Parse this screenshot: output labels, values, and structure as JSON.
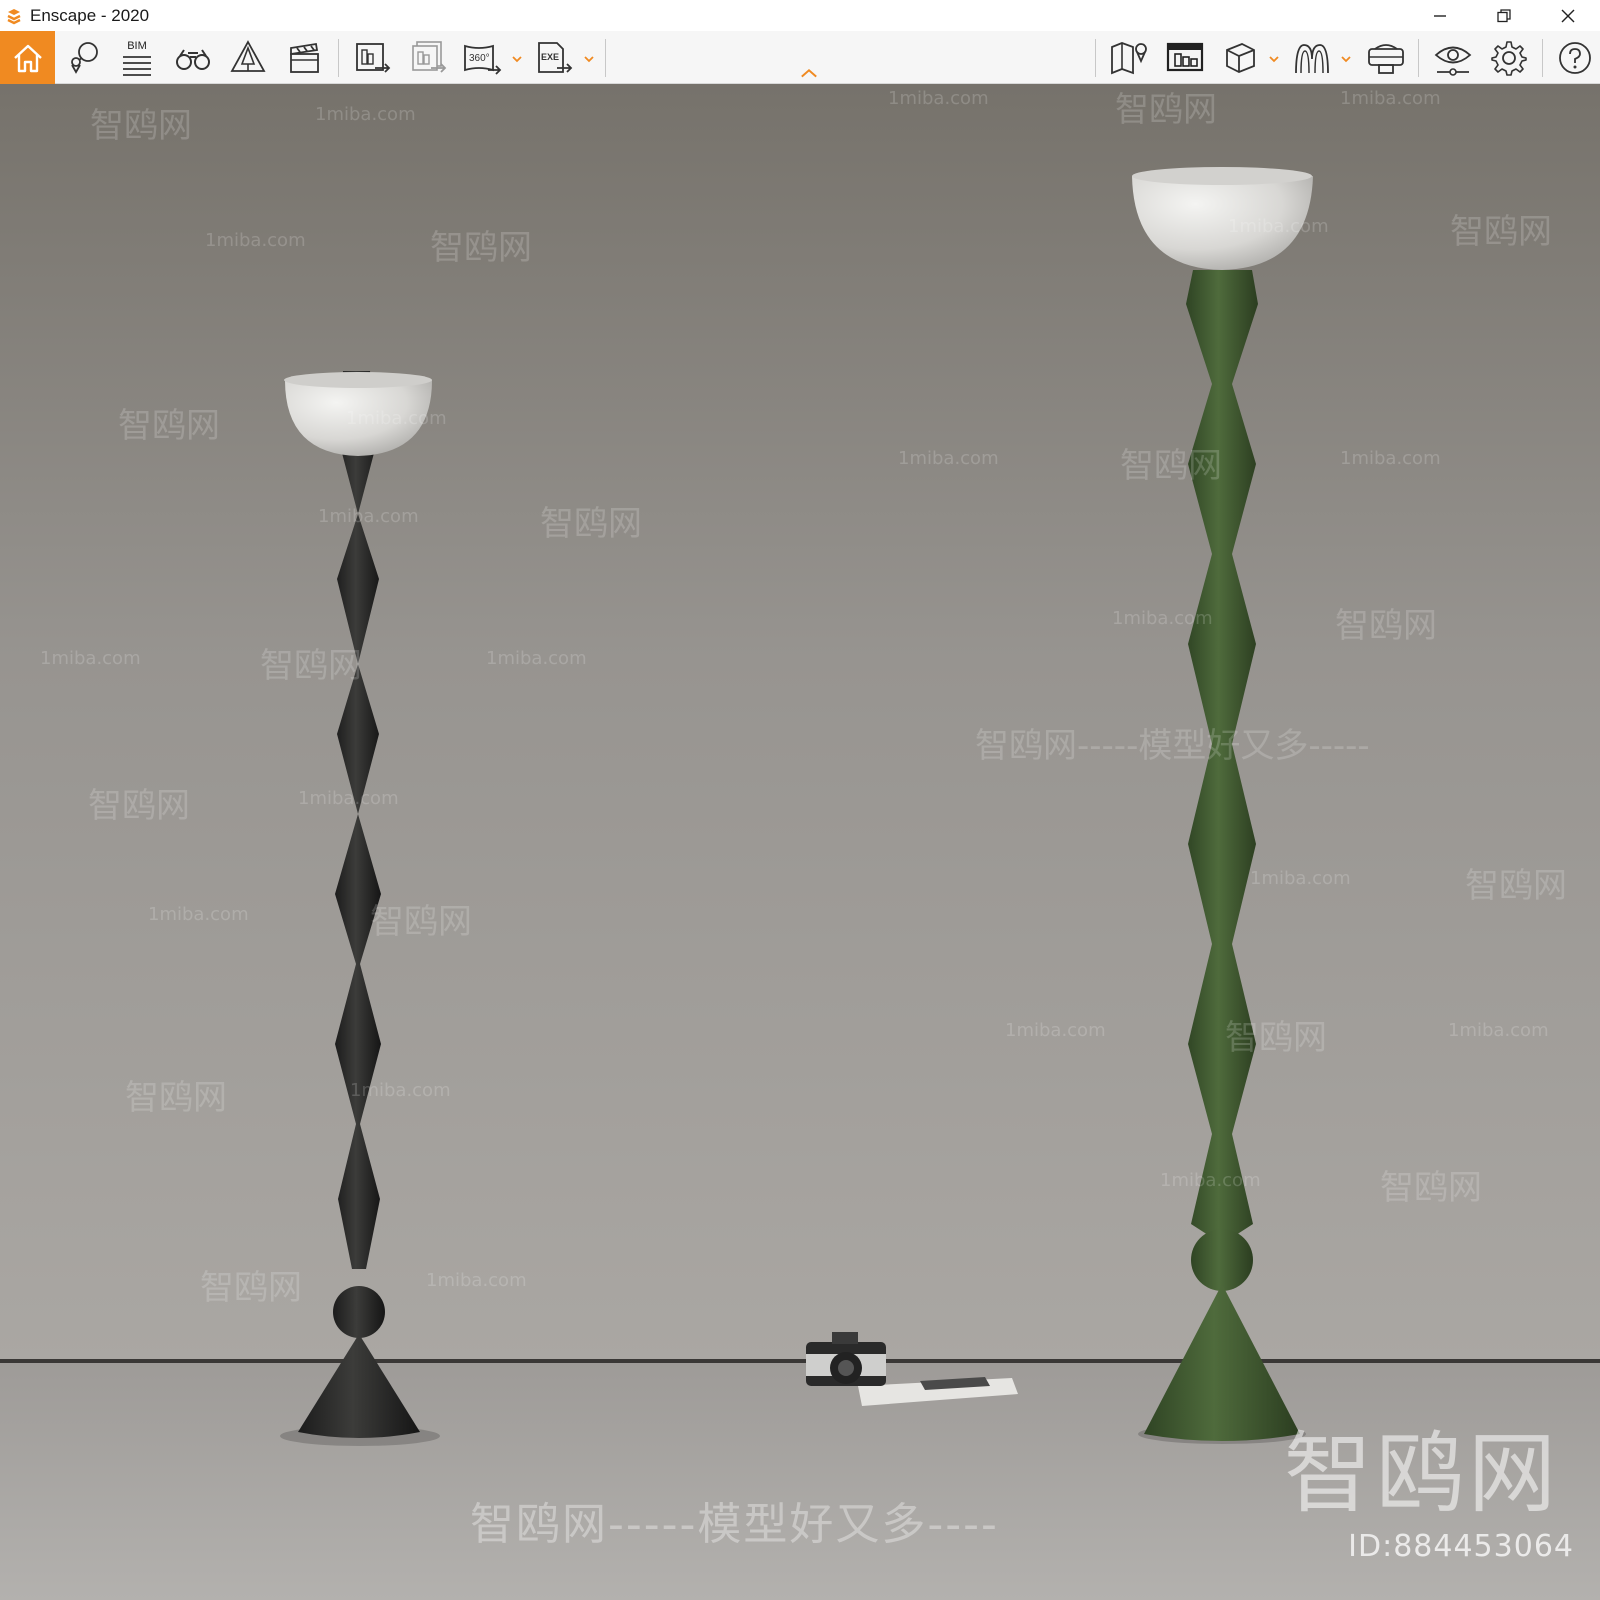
{
  "window": {
    "title": "Enscape - 2020"
  },
  "toolbar": {
    "bim_label": "BIM",
    "icons_left": [
      "home-icon",
      "location-pin-icon",
      "bim-list-icon",
      "binoculars-icon",
      "sound-tree-icon",
      "clapperboard-icon",
      "render-export-icon",
      "batch-render-icon",
      "panorama-360-icon",
      "exe-export-icon"
    ],
    "icons_right": [
      "map-icon",
      "asset-library-icon",
      "cube-view-icon",
      "material-editor-icon",
      "vr-headset-icon",
      "visual-settings-icon",
      "settings-gear-icon",
      "help-icon"
    ],
    "panorama_label": "360°",
    "exe_label": "EXE",
    "accent_color": "#f08a21"
  },
  "viewport": {
    "watermarks": {
      "site": "1miba.com",
      "brand": "智鸥网",
      "slogan": "智鸥网-----模型好又多----",
      "slogan_mid": "智鸥网-----模型好又多-----",
      "big": "智鸥网",
      "id": "ID:884453064"
    }
  }
}
